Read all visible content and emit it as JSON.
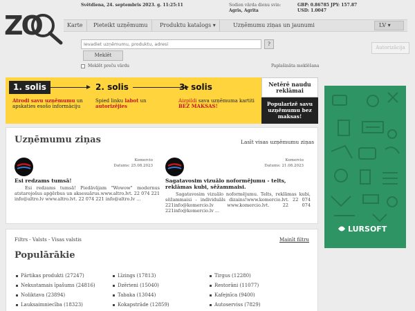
{
  "header": {
    "date": "Svētdiena, 24. septembris 2023. g. 11:25:11",
    "welcome_line1": "Sodien vārda dienu svin:",
    "welcome_names": "Agris, Agrita",
    "rate1": "GBP: 0.86785  JPY: 157.87",
    "rate2": "USD: 1.0047",
    "login_label": "Autorizācija"
  },
  "nav": {
    "items": [
      "Karte",
      "Pieteikt uzņēmumu",
      "Produktu katalogs ▾",
      "Uzņēmumu ziņas un jaunumi"
    ],
    "lang": "LV ▾"
  },
  "search": {
    "placeholder": "Ievadiet uzņēmumu, produktu, adresi",
    "help": "?",
    "button": "Meklēt",
    "checkbox_label": "Meklēt preču vārdu",
    "advanced": "Paplašināta meklēšana"
  },
  "steps": [
    {
      "label": "1. solis",
      "pre": "",
      "red": "Atrodi savu uzņēmumu",
      "post": " un apskaties esošo informāciju"
    },
    {
      "label": "2. solis",
      "pre": "Spied linku ",
      "red": "labot",
      "post": " un ",
      "red2": "autorizējies"
    },
    {
      "label": "3. solis",
      "pre": "",
      "red": "Aizpildi",
      "post": " sava uzņēmuma kartiti ",
      "red2": "BEZ MAKSAS!"
    }
  ],
  "promo": {
    "white": "Netērē naudu reklāmai",
    "dark": "Popularizē savu uzņēmumu bez maksas!"
  },
  "news": {
    "title": "Uzņēmumu ziņas",
    "all_link": "Lasīt visas uzņēmumu ziņas",
    "items": [
      {
        "source": "Komercio",
        "date": "Datums: 25.08.2023",
        "headline": "Esi redzams tumsā!",
        "body": "Esi redzams tumsā! Piedāvājam \"Wowow\" modernus atstarojošus apģērbus un aksesuārus.www.altro.lvt. 22 074 221 info@altro.lv www.altro.lvt. 22 074 221 info@altro.lv ..."
      },
      {
        "source": "Komercio",
        "date": "Datums: 21.08.2023",
        "headline": "Sagatavosim vizuālo noformējumu - telts, reklāmas kubi, sēžammaisi.",
        "body": "Sagatavosim vizuālo noformējumu. Telts, reklāmas kubi, sēžammaisi - individuāls dizains!www.komercio.lvt. 22 074 221info@komercio.lv www.komercio.lvt. 22 074 221info@komercio.lv ..."
      }
    ]
  },
  "popular": {
    "filter": "Filtrs - Valsts - Visas valstis",
    "change_filter": "Mainīt filtru",
    "title": "Populārākie",
    "columns": [
      [
        "Pārtikas produkti (27247)",
        "Nekustamais īpašums (24816)",
        "Noliktava (23894)",
        "Lauksaimniecība (18323)"
      ],
      [
        "Līzings (17813)",
        "Dzērieni (15040)",
        "Tabaka (13044)",
        "Kokapstrāde (12859)"
      ],
      [
        "Tirgus (12280)",
        "Restorāni (11077)",
        "Kafejnīca (9400)",
        "Autoserviss (7829)"
      ]
    ]
  },
  "ad": {
    "brand": "LURSOFT"
  },
  "colors": {
    "banner": "#ffd43d",
    "accent_red": "#c0171d",
    "ad_green": "#2f9464",
    "dark": "#222222"
  }
}
